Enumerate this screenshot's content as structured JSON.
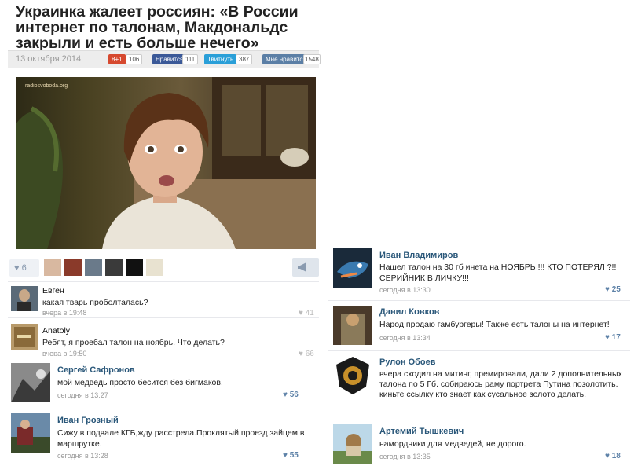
{
  "article": {
    "headline": "Украинка жалеет россиян: «В России интернет по талонам, Макдональдс закрыли и есть больше нечего»",
    "date": "13 октября 2014",
    "share": [
      {
        "label": "8+1",
        "count": "106",
        "color": "#d6492f"
      },
      {
        "label": "Нравится",
        "count": "111",
        "color": "#3b5998"
      },
      {
        "label": "Твитнуть",
        "count": "387",
        "color": "#2a9fd8"
      },
      {
        "label": "Мне нравится",
        "count": "1548",
        "color": "#5b7fa6"
      }
    ],
    "watermark": "radiosvoboda.org",
    "like_count": "6"
  },
  "comments_left": [
    {
      "name": "Евген",
      "text": "какая тварь проболталась?",
      "time": "вчера в 19:48",
      "likes": "41"
    },
    {
      "name": "Anatoly",
      "text": "Ребят, я проебал талон на ноябрь. Что делать?",
      "time": "вчера в 19:50",
      "likes": "66"
    },
    {
      "name": "Сергей Сафронов",
      "text": "мой медведь просто бесится без бигмаков!",
      "time": "сегодня в 13:27",
      "likes": "56"
    },
    {
      "name": "Иван Грозный",
      "text": "Сижу в подвале КГБ,жду расстрела.Проклятый проезд зайцем в маршрутке.",
      "time": "сегодня в 13:28",
      "likes": "55"
    }
  ],
  "comments_right": [
    {
      "name": "Иван Владимиров",
      "text": "Нашел талон на 30 гб инета на НОЯБРЬ !!! КТО ПОТЕРЯЛ ?!! СЕРИЙНИК В ЛИЧКУ!!!",
      "time": "сегодня в 13:30",
      "likes": "25"
    },
    {
      "name": "Данил Ковков",
      "text": "Народ продаю гамбургеры! Также есть талоны на интернет!",
      "time": "сегодня в 13:34",
      "likes": "17"
    },
    {
      "name": "Рулон Обоев",
      "text": "вчера сходил на митинг, премировали, дали 2 дополнительных талона по 5 Гб. собираюсь раму портрета Путина позолотить. киньте ссылку кто знает как сусальное золото делать.",
      "time": "",
      "likes": ""
    },
    {
      "name": "Артемий Тышкевич",
      "text": "намордники для медведей, не дорого.",
      "time": "сегодня в 13:35",
      "likes": "18"
    }
  ],
  "colors": {
    "name": "#2b587a",
    "like": "#5e82a8",
    "muted": "#999999"
  }
}
